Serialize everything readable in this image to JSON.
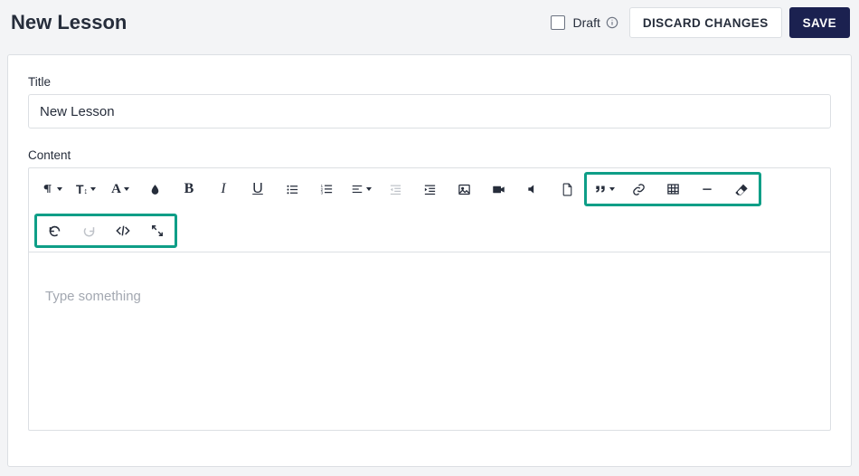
{
  "header": {
    "title": "New Lesson",
    "draft_label": "Draft",
    "discard_label": "DISCARD CHANGES",
    "save_label": "SAVE"
  },
  "form": {
    "title_label": "Title",
    "title_value": "New Lesson",
    "content_label": "Content",
    "editor_placeholder": "Type something"
  }
}
